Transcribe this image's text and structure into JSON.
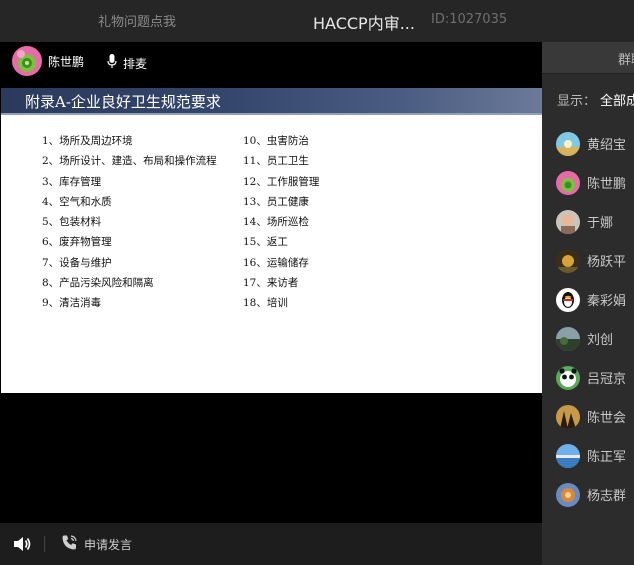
{
  "topbar": {
    "gift_link": "礼物问题点我",
    "title": "HACCP内审...",
    "room_id": "ID:1027035"
  },
  "presenter": {
    "name": "陈世鹏",
    "mic_label": "排麦"
  },
  "slide": {
    "title": "附录A-企业良好卫生规范要求",
    "col1": [
      "1、场所及周边环境",
      "2、场所设计、建造、布局和操作流程",
      "3、库存管理",
      "4、空气和水质",
      "5、包装材料",
      "6、废弃物管理",
      "7、设备与维护",
      "8、产品污染风险和隔离",
      "9、清洁消毒"
    ],
    "col2": [
      "10、虫害防治",
      "11、员工卫生",
      "12、工作服管理",
      "13、员工健康",
      "14、场所巡检",
      "15、返工",
      "16、运输储存",
      "17、来访者",
      "18、培训"
    ]
  },
  "bottombar": {
    "apply_label": "申请发言"
  },
  "sidepanel": {
    "tab_label": "群聊",
    "filter_label": "显示：",
    "filter_value": "全部成员",
    "members": [
      {
        "name": "黄绍宝"
      },
      {
        "name": "陈世鹏"
      },
      {
        "name": "于娜"
      },
      {
        "name": "杨跃平"
      },
      {
        "name": "秦彩娟"
      },
      {
        "name": "刘创"
      },
      {
        "name": "吕冠京"
      },
      {
        "name": "陈世会"
      },
      {
        "name": "陈正军"
      },
      {
        "name": "杨志群"
      }
    ]
  },
  "colors": {
    "topbar_bg": "#262626",
    "panel_bg": "#2c2c2c",
    "slide_header": "#2b3a5c"
  }
}
